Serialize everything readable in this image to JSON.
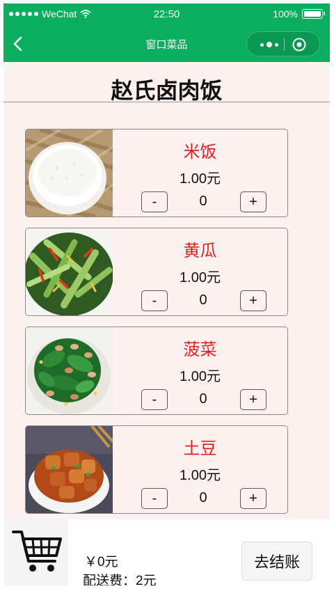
{
  "status_bar": {
    "carrier": "WeChat",
    "time": "22:50",
    "battery": "100%"
  },
  "nav": {
    "title": "窗口菜品"
  },
  "shop": {
    "name": "赵氏卤肉饭"
  },
  "dishes": [
    {
      "name": "米饭",
      "price": "1.00元",
      "count": "0",
      "minus": "-",
      "plus": "+",
      "image": "rice-bowl"
    },
    {
      "name": "黄瓜",
      "price": "1.00元",
      "count": "0",
      "minus": "-",
      "plus": "+",
      "image": "cucumber-salad"
    },
    {
      "name": "菠菜",
      "price": "1.00元",
      "count": "0",
      "minus": "-",
      "plus": "+",
      "image": "spinach-peanuts"
    },
    {
      "name": "土豆",
      "price": "1.00元",
      "count": "0",
      "minus": "-",
      "plus": "+",
      "image": "braised-potatoes"
    }
  ],
  "cart": {
    "total": "￥0元",
    "delivery_fee": "配送费：2元",
    "checkout_label": "去结账"
  },
  "colors": {
    "brand_green": "#0aae5e",
    "dish_name_red": "#e02020",
    "page_bg": "#fdf2f0"
  },
  "icons": [
    "back-chevron-icon",
    "wifi-icon",
    "battery-icon",
    "more-dots-icon",
    "close-target-icon",
    "cart-icon"
  ]
}
